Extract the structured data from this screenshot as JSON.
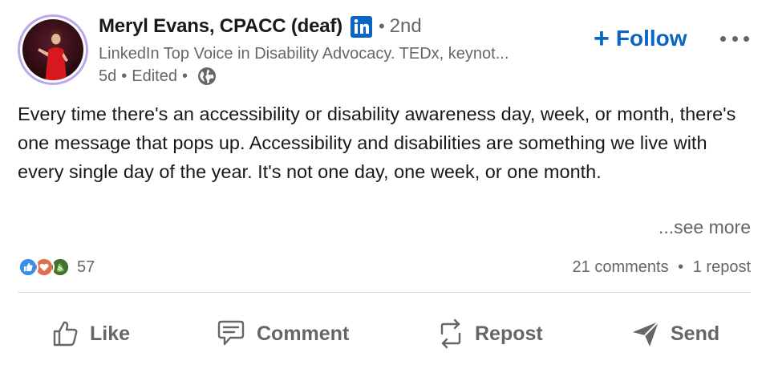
{
  "post": {
    "author": {
      "name": "Meryl Evans, CPACC (deaf)",
      "degree": "2nd",
      "headline": "LinkedIn Top Voice in Disability Advocacy. TEDx, keynot...",
      "time": "5d",
      "edited": "Edited"
    },
    "follow_label": "Follow",
    "body": "Every time there's an accessibility or disability awareness day, week, or month, there's one message that pops up. Accessibility and disabilities are something we live with every single day of the year. It's not one day, one week, or one month.",
    "see_more": "...see more",
    "reactions_count": "57",
    "comments": "21 comments",
    "reposts": "1 repost"
  },
  "actions": {
    "like": "Like",
    "comment": "Comment",
    "repost": "Repost",
    "send": "Send"
  },
  "colors": {
    "accent": "#0a66c2",
    "text": "#191919",
    "muted": "#666666",
    "avatar_ring": "#b9a8ea"
  },
  "icons": {
    "badge": "linkedin-icon",
    "visibility": "globe-icon",
    "reactions": [
      "like-reaction-icon",
      "love-reaction-icon",
      "celebrate-reaction-icon"
    ]
  }
}
